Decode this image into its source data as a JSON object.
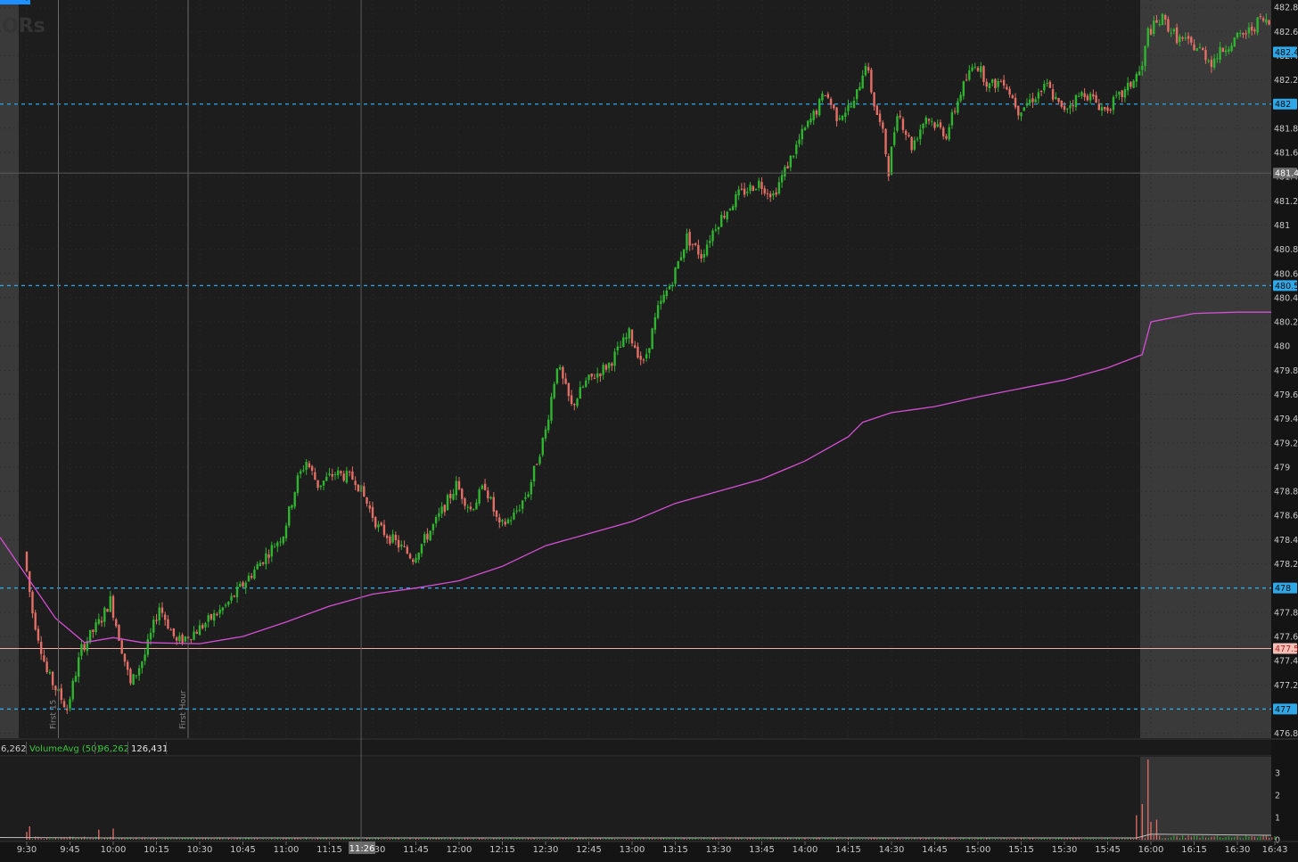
{
  "chart_data": {
    "type": "candlestick",
    "watermark": "ORs",
    "time_labels": [
      "9:30",
      "9:45",
      "10:00",
      "10:15",
      "10:30",
      "10:45",
      "11:00",
      "11:15",
      "11:30",
      "11:45",
      "12:00",
      "12:15",
      "12:30",
      "12:45",
      "13:00",
      "13:15",
      "13:30",
      "13:45",
      "14:00",
      "14:15",
      "14:30",
      "14:45",
      "15:00",
      "15:15",
      "15:30",
      "15:45",
      "16:00",
      "16:15",
      "16:30",
      "16:43"
    ],
    "cursor_time": "11:26",
    "y_ticks": [
      "482.8",
      "482.6",
      "482.4",
      "482.2",
      "482",
      "481.8",
      "481.6",
      "481.4",
      "481.2",
      "481",
      "480.8",
      "480.6",
      "480.4",
      "480.2",
      "480",
      "479.8",
      "479.6",
      "479.4",
      "479.2",
      "479",
      "478.8",
      "478.6",
      "478.4",
      "478.2",
      "478",
      "477.8",
      "477.6",
      "477.4",
      "477.2",
      "477",
      "476.8"
    ],
    "y_range": [
      476.76,
      482.86
    ],
    "price_levels": [
      {
        "label": "482",
        "value": 482.0
      },
      {
        "label": "480.5",
        "value": 480.5
      },
      {
        "label": "478",
        "value": 478.0
      },
      {
        "label": "477",
        "value": 477.0
      }
    ],
    "last_price": {
      "label": "482.4",
      "value": 482.43
    },
    "cursor_price": {
      "label": "481.4",
      "value": 481.43
    },
    "prev_close": {
      "label": "477.5",
      "value": 477.5
    },
    "session_markers": [
      "First 15",
      "First Hour"
    ],
    "vwap": [
      [
        "9:30",
        478.42
      ],
      [
        "9:40",
        477.75
      ],
      [
        "9:50",
        477.55
      ],
      [
        "10:00",
        477.59
      ],
      [
        "10:10",
        477.55
      ],
      [
        "10:30",
        477.54
      ],
      [
        "10:45",
        477.6
      ],
      [
        "11:00",
        477.72
      ],
      [
        "11:15",
        477.85
      ],
      [
        "11:30",
        477.95
      ],
      [
        "11:45",
        478.0
      ],
      [
        "12:00",
        478.06
      ],
      [
        "12:15",
        478.18
      ],
      [
        "12:30",
        478.35
      ],
      [
        "12:45",
        478.45
      ],
      [
        "13:00",
        478.55
      ],
      [
        "13:15",
        478.7
      ],
      [
        "13:30",
        478.8
      ],
      [
        "13:45",
        478.9
      ],
      [
        "14:00",
        479.05
      ],
      [
        "14:15",
        479.25
      ],
      [
        "14:20",
        479.37
      ],
      [
        "14:30",
        479.45
      ],
      [
        "14:45",
        479.5
      ],
      [
        "15:00",
        479.58
      ],
      [
        "15:15",
        479.65
      ],
      [
        "15:30",
        479.72
      ],
      [
        "15:45",
        479.82
      ],
      [
        "15:57",
        479.93
      ],
      [
        "16:00",
        480.2
      ],
      [
        "16:15",
        480.27
      ],
      [
        "16:30",
        480.28
      ],
      [
        "16:43",
        480.28
      ]
    ],
    "price_path": [
      [
        "9:30",
        478.3
      ],
      [
        "9:33",
        477.8
      ],
      [
        "9:38",
        477.3
      ],
      [
        "9:45",
        477.0
      ],
      [
        "9:50",
        477.5
      ],
      [
        "9:57",
        477.75
      ],
      [
        "10:00",
        477.9
      ],
      [
        "10:03",
        477.6
      ],
      [
        "10:07",
        477.2
      ],
      [
        "10:12",
        477.45
      ],
      [
        "10:17",
        477.85
      ],
      [
        "10:23",
        477.55
      ],
      [
        "10:30",
        477.65
      ],
      [
        "10:40",
        477.85
      ],
      [
        "10:50",
        478.15
      ],
      [
        "11:00",
        478.45
      ],
      [
        "11:05",
        478.9
      ],
      [
        "11:08",
        479.05
      ],
      [
        "11:12",
        478.85
      ],
      [
        "11:18",
        478.95
      ],
      [
        "11:25",
        478.9
      ],
      [
        "11:33",
        478.5
      ],
      [
        "11:45",
        478.25
      ],
      [
        "11:53",
        478.55
      ],
      [
        "12:00",
        478.85
      ],
      [
        "12:05",
        478.65
      ],
      [
        "12:10",
        478.85
      ],
      [
        "12:15",
        478.5
      ],
      [
        "12:20",
        478.6
      ],
      [
        "12:25",
        478.8
      ],
      [
        "12:31",
        479.3
      ],
      [
        "12:35",
        479.85
      ],
      [
        "12:40",
        479.5
      ],
      [
        "12:45",
        479.7
      ],
      [
        "12:53",
        479.85
      ],
      [
        "13:00",
        480.1
      ],
      [
        "13:05",
        479.85
      ],
      [
        "13:10",
        480.3
      ],
      [
        "13:15",
        480.55
      ],
      [
        "13:20",
        480.9
      ],
      [
        "13:25",
        480.75
      ],
      [
        "13:30",
        481.0
      ],
      [
        "13:38",
        481.25
      ],
      [
        "13:45",
        481.35
      ],
      [
        "13:50",
        481.25
      ],
      [
        "13:55",
        481.5
      ],
      [
        "14:00",
        481.75
      ],
      [
        "14:05",
        481.95
      ],
      [
        "14:08",
        482.1
      ],
      [
        "14:12",
        481.9
      ],
      [
        "14:18",
        482.0
      ],
      [
        "14:22",
        482.35
      ],
      [
        "14:25",
        482.0
      ],
      [
        "14:28",
        481.75
      ],
      [
        "14:30",
        481.45
      ],
      [
        "14:33",
        481.95
      ],
      [
        "14:38",
        481.65
      ],
      [
        "14:43",
        481.9
      ],
      [
        "14:50",
        481.75
      ],
      [
        "14:55",
        482.1
      ],
      [
        "15:00",
        482.35
      ],
      [
        "15:05",
        482.15
      ],
      [
        "15:10",
        482.2
      ],
      [
        "15:15",
        481.95
      ],
      [
        "15:20",
        482.05
      ],
      [
        "15:25",
        482.15
      ],
      [
        "15:30",
        481.95
      ],
      [
        "15:38",
        482.1
      ],
      [
        "15:45",
        481.95
      ],
      [
        "15:52",
        482.1
      ],
      [
        "15:58",
        482.3
      ],
      [
        "16:00",
        482.6
      ],
      [
        "16:05",
        482.7
      ],
      [
        "16:10",
        482.55
      ],
      [
        "16:18",
        482.45
      ],
      [
        "16:22",
        482.35
      ],
      [
        "16:28",
        482.5
      ],
      [
        "16:35",
        482.6
      ],
      [
        "16:39",
        482.7
      ],
      [
        "16:43",
        482.65
      ]
    ],
    "volume_study": {
      "label_prefix": "6,262",
      "name": "VolumeAvg (50)",
      "avg_value": "96,262",
      "value": "126,431",
      "y_ticks": [
        "3",
        "2",
        "1",
        "0"
      ],
      "y_range": [
        0,
        3.6
      ],
      "spikes": [
        [
          "9:30",
          0.35
        ],
        [
          "9:31",
          0.6
        ],
        [
          "9:55",
          0.45
        ],
        [
          "10:00",
          0.5
        ],
        [
          "15:55",
          1.1
        ],
        [
          "15:57",
          1.6
        ],
        [
          "15:59",
          3.6
        ],
        [
          "16:00",
          0.8
        ],
        [
          "16:02",
          0.9
        ]
      ]
    }
  }
}
